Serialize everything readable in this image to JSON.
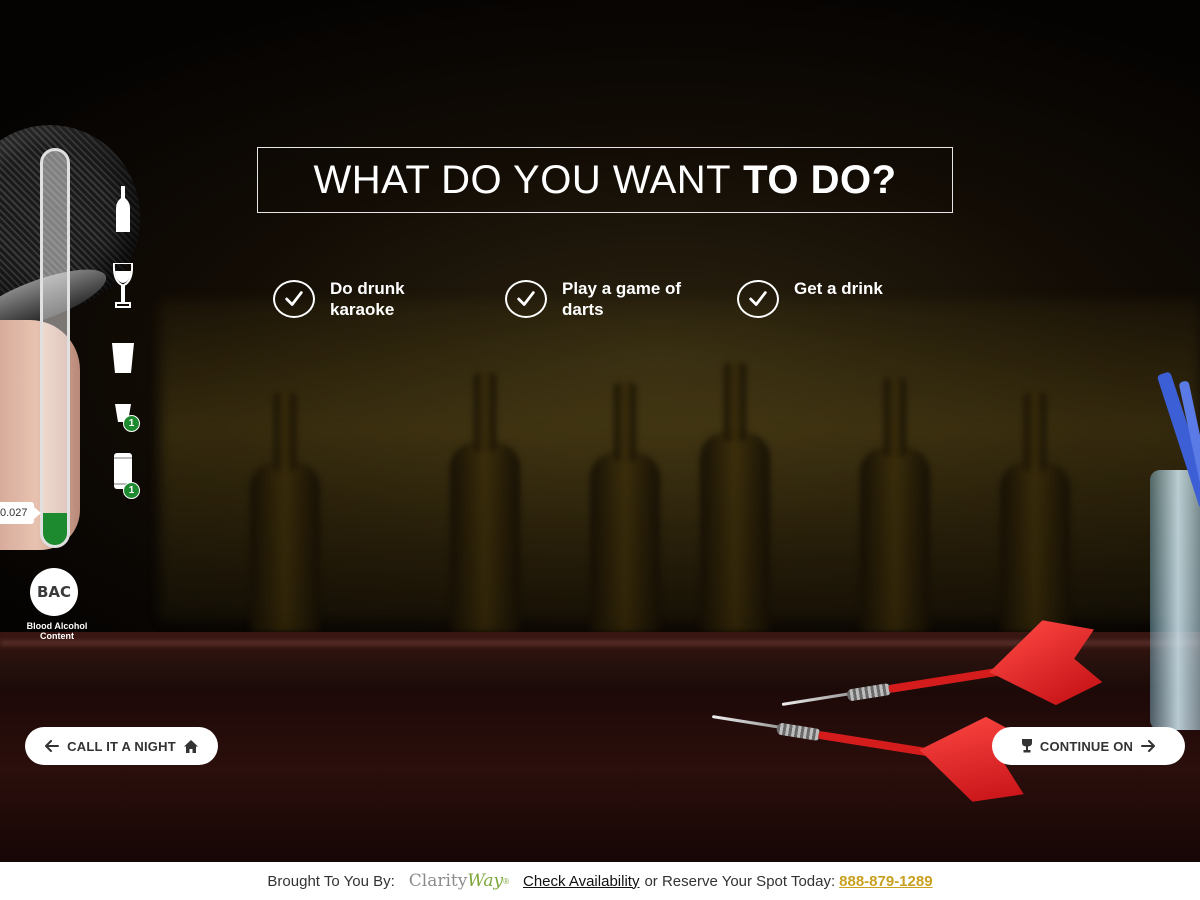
{
  "heading": {
    "normal": "WHAT DO YOU WANT",
    "bold": "TO DO?"
  },
  "options": [
    {
      "label": "Do drunk karaoke"
    },
    {
      "label": "Play a game of darts"
    },
    {
      "label": "Get a drink"
    }
  ],
  "bac_meter": {
    "value": "0.027",
    "fill_fraction": 0.08,
    "circle_label": "BAC",
    "caption": "Blood Alcohol Content",
    "fill_color": "#1e8a2f",
    "drinks": [
      {
        "icon": "liquor-bottle-icon",
        "count": null
      },
      {
        "icon": "wine-glass-icon",
        "count": null
      },
      {
        "icon": "pint-glass-icon",
        "count": null
      },
      {
        "icon": "shot-glass-icon",
        "count": "1"
      },
      {
        "icon": "beer-can-icon",
        "count": "1"
      }
    ]
  },
  "nav": {
    "left_label": "CALL IT A NIGHT",
    "right_label": "CONTINUE ON"
  },
  "footer": {
    "brought": "Brought To You By:",
    "logo_part1": "Clarity",
    "logo_part2": "Way",
    "logo_mark": "®",
    "link": "Check Availability",
    "middle": "or Reserve Your Spot Today:",
    "phone": "888-879-1289"
  }
}
